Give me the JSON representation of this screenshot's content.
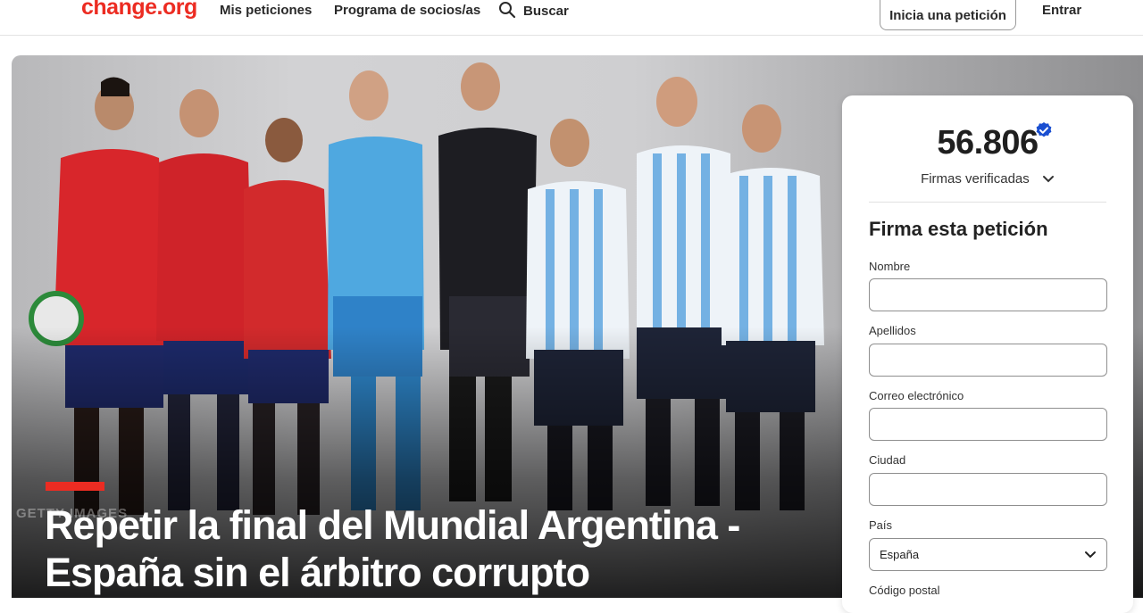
{
  "header": {
    "logo": "change.org",
    "nav": {
      "my_petitions": "Mis peticiones",
      "partners": "Programa de socios/as",
      "search": "Buscar"
    },
    "start_petition": "Inicia una petición",
    "login": "Entrar",
    "icons": {
      "search": "search-icon"
    }
  },
  "hero": {
    "watermark": "GETTY IMAGES",
    "title": "Repetir la final del Mundial Argentina - España sin el árbitro corrupto",
    "accent_color": "#ec2c22"
  },
  "sign_card": {
    "count": "56.806",
    "verified_label": "Firmas verificadas",
    "form_title": "Firma esta petición",
    "fields": {
      "first_name": {
        "label": "Nombre",
        "value": ""
      },
      "last_name": {
        "label": "Apellidos",
        "value": ""
      },
      "email": {
        "label": "Correo electrónico",
        "value": ""
      },
      "city": {
        "label": "Ciudad",
        "value": ""
      },
      "country": {
        "label": "País",
        "value": "España"
      },
      "postal_code": {
        "label": "Código postal"
      }
    },
    "colors": {
      "verified_badge": "#1a4fd1"
    }
  }
}
